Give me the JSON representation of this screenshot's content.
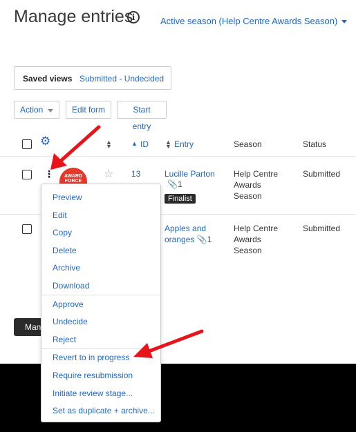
{
  "header": {
    "title": "Manage entries",
    "season_selector": "Active season (Help Centre Awards Season)"
  },
  "saved_views": {
    "label": "Saved views",
    "value": "Submitted - Undecided"
  },
  "toolbar": {
    "action_label": "Action",
    "edit_form_label": "Edit form",
    "start_entry_label": "Start entry"
  },
  "table": {
    "columns": {
      "id": "ID",
      "entry": "Entry",
      "season": "Season",
      "status": "Status"
    },
    "rows": [
      {
        "id": "13",
        "entry": "Lucille Parton",
        "attachments": "1",
        "badge": "Finalist",
        "season": [
          "Help Centre",
          "Awards",
          "Season"
        ],
        "status": "Submitted",
        "logo_text": "AWARD FORCE"
      },
      {
        "id": "",
        "entry_lines": [
          "Apples and",
          "oranges"
        ],
        "attachments": "1",
        "season": [
          "Help Centre",
          "Awards",
          "Season"
        ],
        "status": "Submitted"
      }
    ]
  },
  "manage_button": "Man",
  "row_menu": {
    "group1": [
      "Preview",
      "Edit",
      "Copy",
      "Delete",
      "Archive",
      "Download"
    ],
    "group2": [
      "Approve",
      "Undecide",
      "Reject"
    ],
    "group3": [
      "Revert to in progress",
      "Require resubmission",
      "Initiate review stage...",
      "Set as duplicate + archive..."
    ]
  },
  "icons": {
    "info": "info-icon",
    "gear": "gear-icon",
    "star": "star-icon",
    "kebab": "kebab-menu-icon",
    "paperclip": "paperclip-icon",
    "sort": "sort-icon"
  },
  "colors": {
    "link": "#1f66c9",
    "annotation_arrow": "#e8141b",
    "badge_bg": "#2b2b2b",
    "logo_bg": "#e5372a"
  }
}
